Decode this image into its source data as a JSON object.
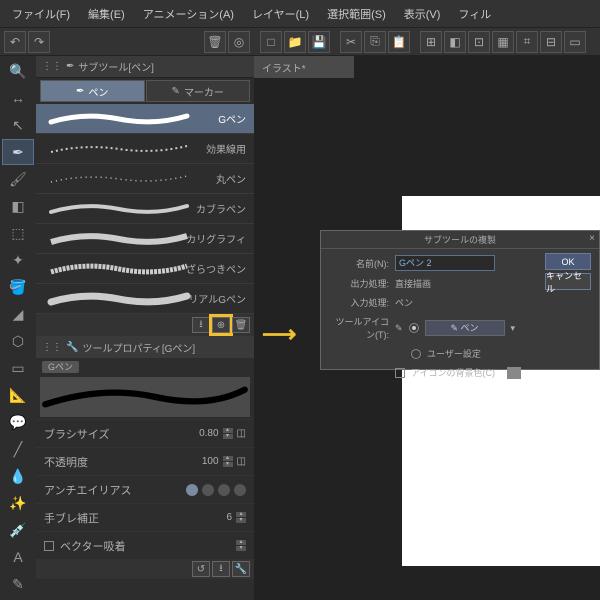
{
  "menu": {
    "file": "ファイル(F)",
    "edit": "編集(E)",
    "anim": "アニメーション(A)",
    "layer": "レイヤー(L)",
    "select": "選択範囲(S)",
    "view": "表示(V)",
    "filter": "フィル"
  },
  "doc": {
    "tab": "イラスト*"
  },
  "subtool": {
    "panel_title": "サブツール[ペン]",
    "tabs": {
      "pen": "ペン",
      "marker": "マーカー"
    },
    "items": [
      "Gペン",
      "効果線用",
      "丸ペン",
      "カブラペン",
      "カリグラフィ",
      "ざらつきペン",
      "リアルGペン"
    ]
  },
  "prop": {
    "panel_title": "ツールプロパティ[Gペン]",
    "pill": "Gペン",
    "rows": {
      "brush_size": "ブラシサイズ",
      "brush_size_v": "0.80",
      "opacity": "不透明度",
      "opacity_v": "100",
      "aa": "アンチエイリアス",
      "stab": "手ブレ補正",
      "stab_v": "6",
      "vector": "ベクター吸着"
    }
  },
  "dialog": {
    "title": "サブツールの複製",
    "name_l": "名前(N):",
    "name_v": "Gペン 2",
    "out_l": "出力処理:",
    "out_v": "直接描画",
    "in_l": "入力処理:",
    "in_v": "ペン",
    "icon_l": "ツールアイコン(T):",
    "icon_sel": "✎ ペン",
    "user": "ユーザー設定",
    "bg": "アイコンの背景色(C)",
    "ok": "OK",
    "cancel": "キャンセル"
  }
}
